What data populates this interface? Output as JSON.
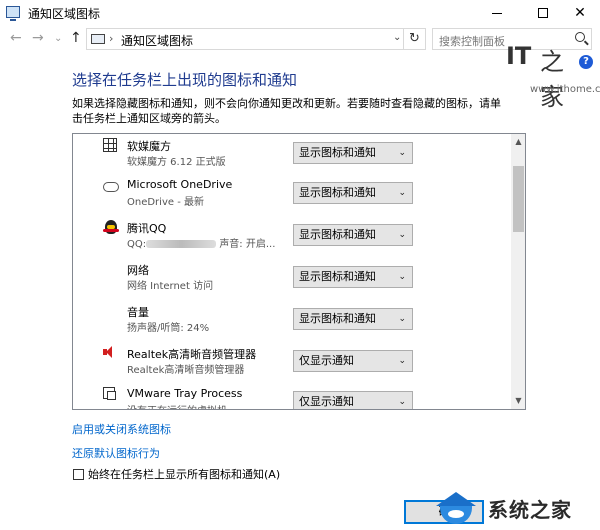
{
  "window": {
    "title": "通知区域图标",
    "minimize": "minimize",
    "maximize": "maximize",
    "close": "✕"
  },
  "nav": {
    "back": "←",
    "forward": "→",
    "recent": "⌄",
    "up": "↑",
    "separator": "›",
    "breadcrumb": "通知区域图标",
    "dropdown": "⌄",
    "refresh": "↻",
    "search_placeholder": "搜索控制面板"
  },
  "watermark": {
    "it": "IT",
    "zh": "之家",
    "url": "www.ithome.com",
    "help": "?"
  },
  "main": {
    "heading": "选择在任务栏上出现的图标和通知",
    "description": "如果选择隐藏图标和通知，则不会向你通知更改和更新。若要随时查看隐藏的图标，请单击任务栏上通知区域旁的箭头。"
  },
  "list": {
    "items": [
      {
        "name": "软媒魔方",
        "sub": "软媒魔方 6.12 正式版",
        "behavior": "显示图标和通知",
        "icon": "grid-icon"
      },
      {
        "name": "Microsoft OneDrive",
        "sub": "OneDrive - 最新",
        "behavior": "显示图标和通知",
        "icon": "cloud-icon"
      },
      {
        "name": "腾讯QQ",
        "sub_prefix": "QQ:",
        "sub_suffix": "声音: 开启...",
        "behavior": "显示图标和通知",
        "icon": "qq-icon"
      },
      {
        "name": "网络",
        "sub": "网络 Internet 访问",
        "behavior": "显示图标和通知",
        "icon": "none"
      },
      {
        "name": "音量",
        "sub": "扬声器/听筒: 24%",
        "behavior": "显示图标和通知",
        "icon": "none"
      },
      {
        "name": "Realtek高清晰音频管理器",
        "sub": "Realtek高清晰音频管理器",
        "behavior": "仅显示通知",
        "icon": "speaker-icon"
      },
      {
        "name": "VMware Tray Process",
        "sub": "没有正在运行的虚拟机",
        "behavior": "仅显示通知",
        "icon": "vm-icon"
      }
    ],
    "dropdown_arrow": "⌄",
    "scroll_up": "▲",
    "scroll_down": "▼"
  },
  "links": {
    "system_icons": "启用或关闭系统图标",
    "restore_default": "还原默认图标行为"
  },
  "always_show": {
    "label": "始终在任务栏上显示所有图标和通知(A)",
    "checked": false
  },
  "buttons": {
    "ok": "确"
  },
  "footer_watermark": {
    "text": "系统之家"
  }
}
